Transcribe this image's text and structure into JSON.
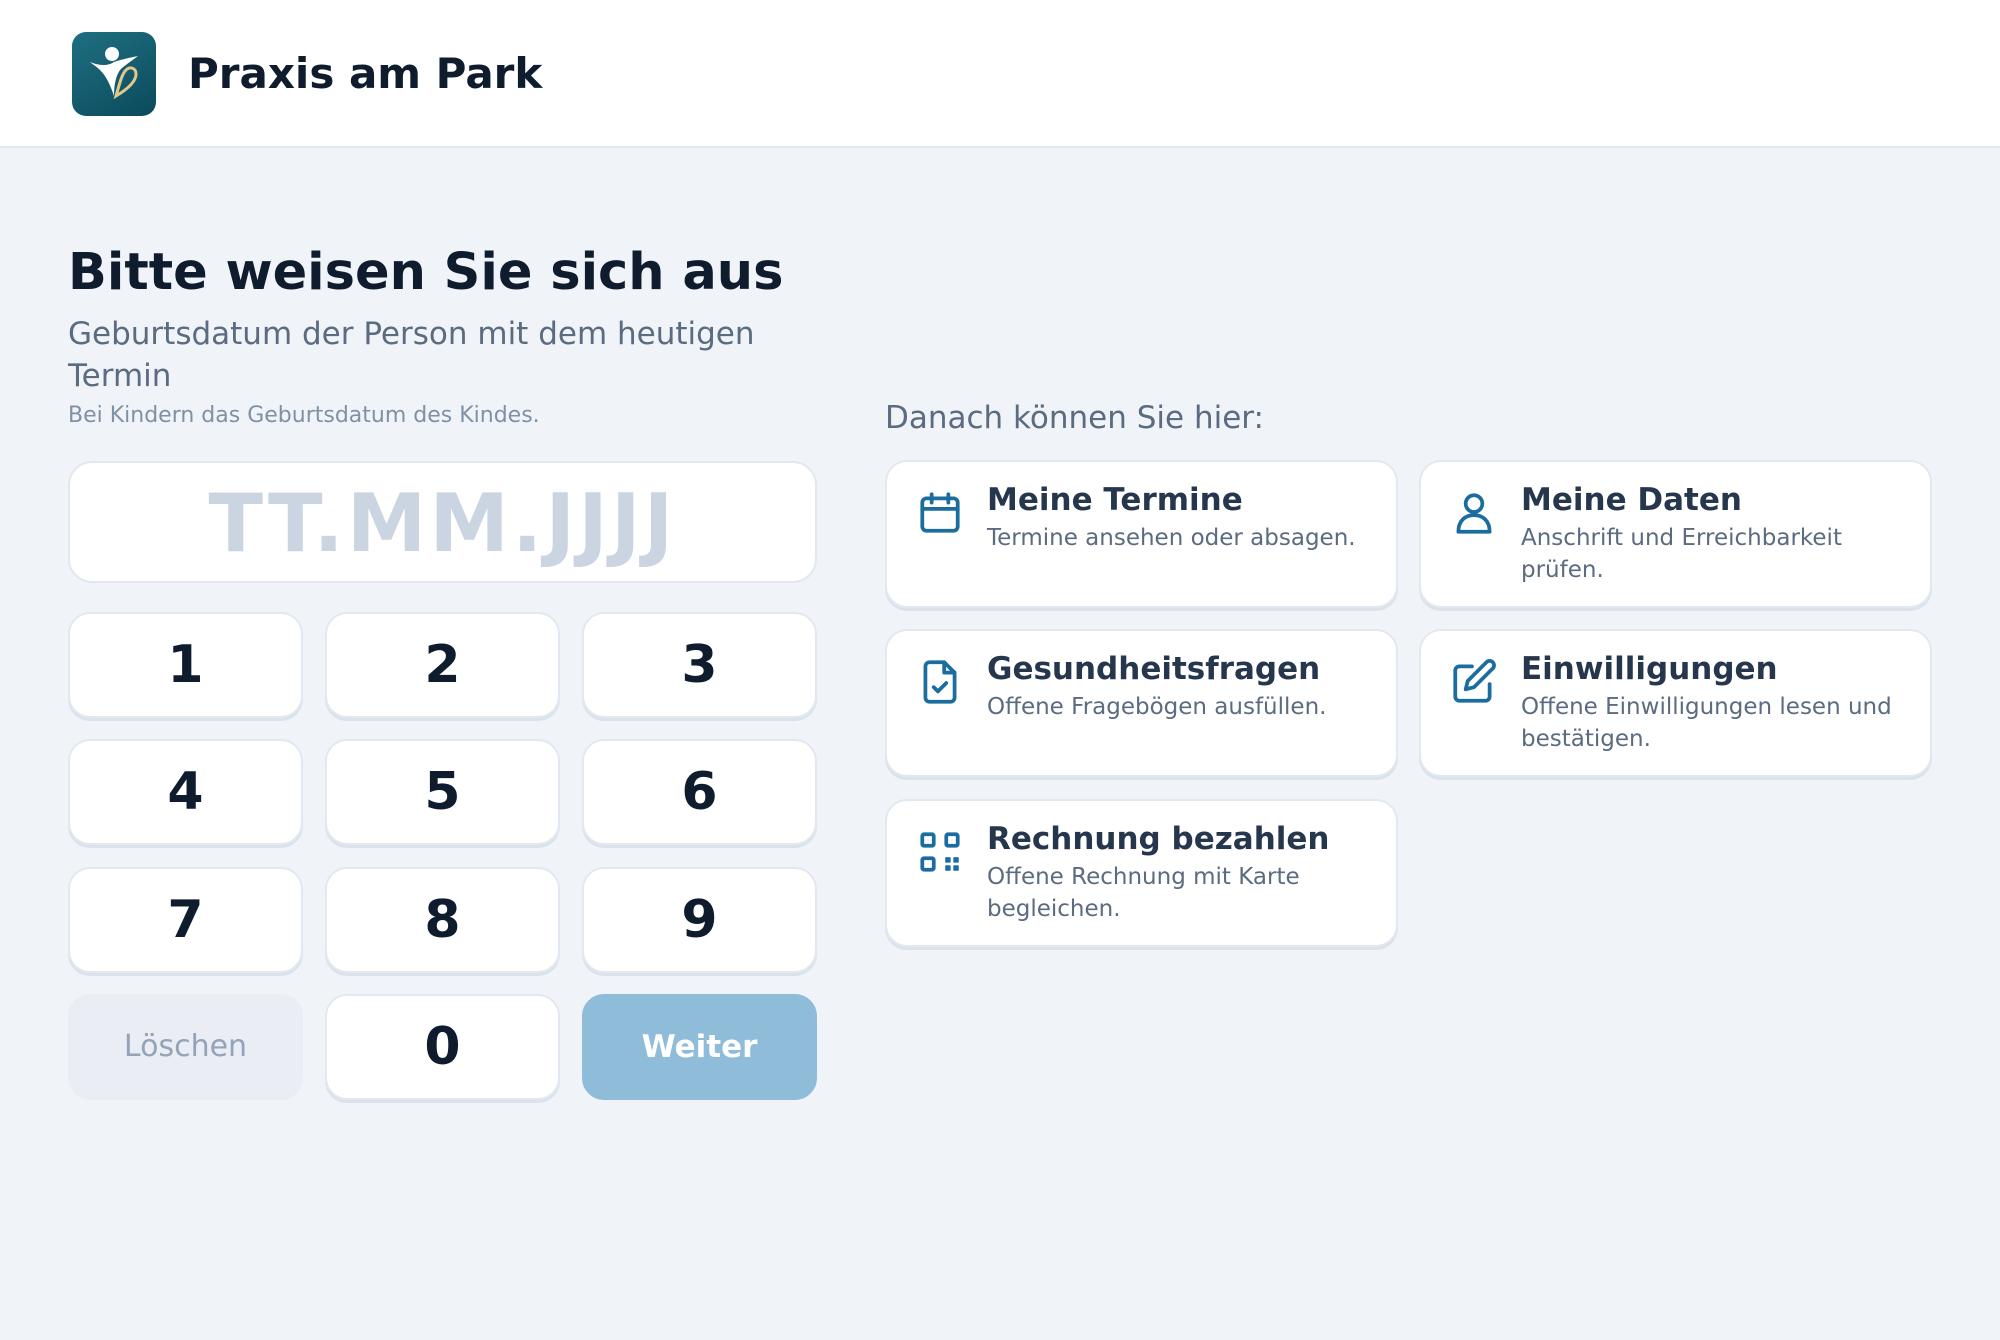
{
  "header": {
    "brand": "Praxis am Park",
    "logo_icon": "person-heart-logo-icon"
  },
  "login": {
    "title": "Bitte weisen Sie sich aus",
    "subtitle": "Geburtsdatum der Person mit dem heutigen Termin",
    "hint": "Bei Kindern das Geburtsdatum des Kindes.",
    "date_placeholder": "TT.MM.JJJJ",
    "keys": [
      "1",
      "2",
      "3",
      "4",
      "5",
      "6",
      "7",
      "8",
      "9",
      "0"
    ],
    "clear_label": "Löschen",
    "next_label": "Weiter"
  },
  "features": {
    "heading": "Danach können Sie hier:",
    "items": [
      {
        "title": "Meine Termine",
        "description": "Termine ansehen oder absagen.",
        "icon": "calendar-icon"
      },
      {
        "title": "Meine Daten",
        "description": "Anschrift und Erreichbarkeit prüfen.",
        "icon": "user-icon"
      },
      {
        "title": "Gesundheitsfragen",
        "description": "Offene Fragebögen ausfüllen.",
        "icon": "file-check-icon"
      },
      {
        "title": "Einwilligungen",
        "description": "Offene Einwilligungen lesen und bestätigen.",
        "icon": "pencil-square-icon"
      },
      {
        "title": "Rechnung bezahlen",
        "description": "Offene Rechnung mit Karte begleichen.",
        "icon": "qr-code-icon"
      }
    ]
  },
  "colors": {
    "accent": "#1a6d9e",
    "next_button": "#8fbcd9",
    "background": "#f0f4f9"
  }
}
